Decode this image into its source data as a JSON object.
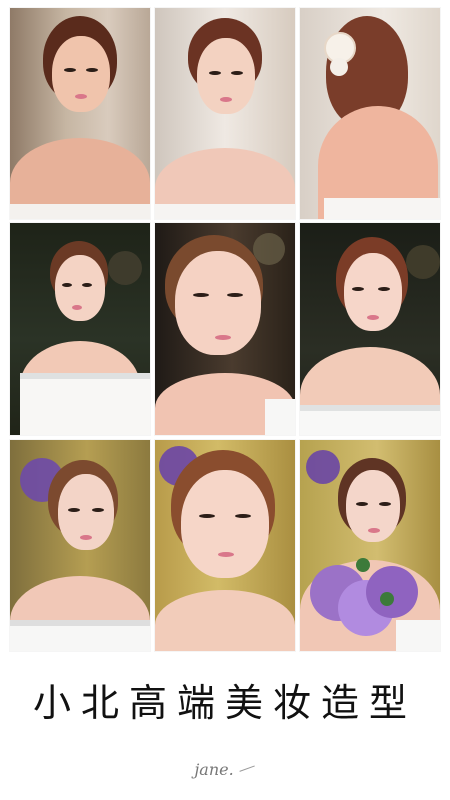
{
  "photos": [
    {
      "name": "photo-1",
      "desc_icon": "portrait-photo"
    },
    {
      "name": "photo-2",
      "desc_icon": "portrait-photo"
    },
    {
      "name": "photo-3",
      "desc_icon": "portrait-photo"
    },
    {
      "name": "photo-4",
      "desc_icon": "portrait-photo"
    },
    {
      "name": "photo-5",
      "desc_icon": "portrait-photo"
    },
    {
      "name": "photo-6",
      "desc_icon": "portrait-photo"
    },
    {
      "name": "photo-7",
      "desc_icon": "portrait-photo"
    },
    {
      "name": "photo-8",
      "desc_icon": "portrait-photo"
    },
    {
      "name": "photo-9",
      "desc_icon": "portrait-photo"
    }
  ],
  "caption": {
    "title": "小北高端美妆造型"
  },
  "signature": {
    "text": "jane."
  },
  "colors": {
    "background": "#ffffff",
    "caption_text": "#111111",
    "signature_text": "#777777"
  }
}
